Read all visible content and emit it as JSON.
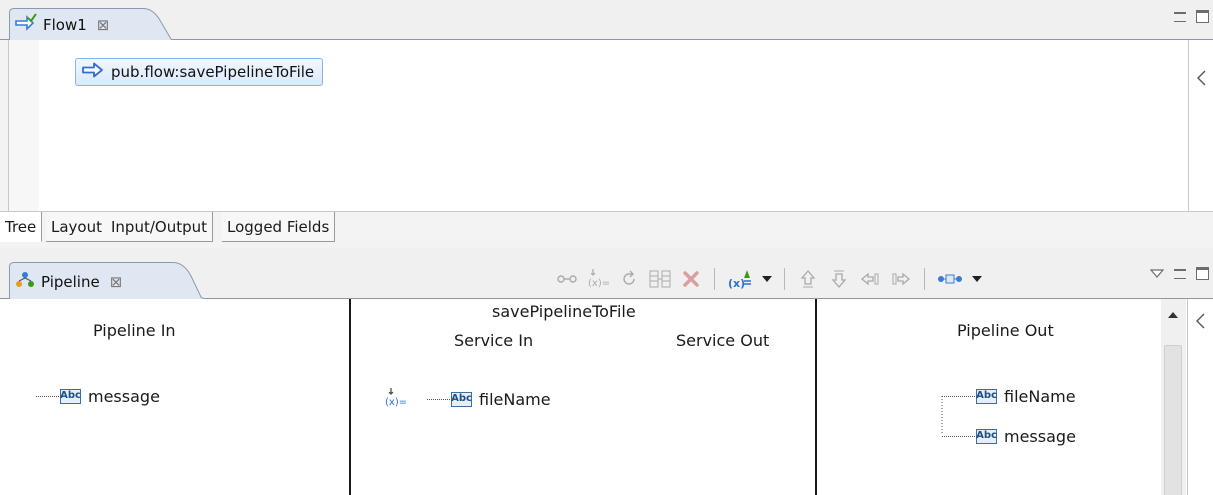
{
  "editor": {
    "tab_title": "Flow1",
    "close_glyph": "⊠",
    "flow_step": "pub.flow:savePipelineToFile",
    "flow_step_icon": "arrow-right-icon",
    "bottom_tabs": [
      "Tree",
      "Layout",
      "Input/Output",
      "Logged Fields"
    ]
  },
  "pipeline": {
    "tab_title": "Pipeline",
    "close_glyph": "⊠",
    "service_name": "savePipelineToFile",
    "pipeline_in": {
      "title": "Pipeline In",
      "fields": [
        {
          "name": "message",
          "type": "String",
          "icon": "abc-icon"
        }
      ]
    },
    "service_in": {
      "title": "Service In",
      "fields": [
        {
          "name": "fileName",
          "type": "String",
          "icon": "abc-icon"
        }
      ]
    },
    "service_out": {
      "title": "Service Out",
      "fields": []
    },
    "pipeline_out": {
      "title": "Pipeline Out",
      "fields": [
        {
          "name": "fileName",
          "type": "String",
          "icon": "abc-icon"
        },
        {
          "name": "message",
          "type": "String",
          "icon": "abc-icon"
        }
      ]
    },
    "abc_label": "Abc"
  },
  "colors": {
    "accent_blue": "#3a7bd5",
    "tab_border": "#8a9aac",
    "disabled_icon": "#aaaaaa",
    "delete_red": "#d9a0a0"
  }
}
